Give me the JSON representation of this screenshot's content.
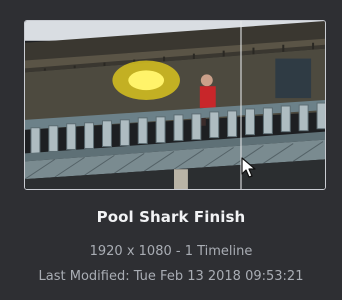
{
  "project": {
    "title": "Pool Shark Finish",
    "resolution_timelines": "1920 x 1080 - 1 Timeline",
    "last_modified": "Last Modified: Tue Feb 13 2018 09:53:21"
  },
  "thumbnail": {
    "scrub_position": 0.72
  },
  "icons": {
    "pointer": "cursor-arrow-icon"
  }
}
